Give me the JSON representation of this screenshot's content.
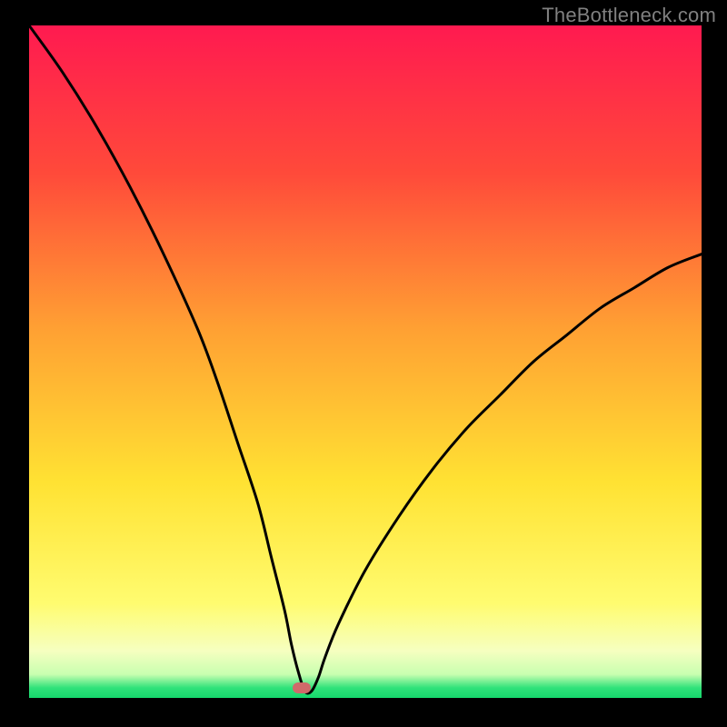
{
  "watermark": "TheBottleneck.com",
  "marker": {
    "color": "#d06a6a",
    "x_frac": 0.405,
    "y_frac": 0.985
  },
  "gradient": {
    "stops": [
      {
        "pos": 0.0,
        "color": "#ff1a50"
      },
      {
        "pos": 0.22,
        "color": "#ff4a3a"
      },
      {
        "pos": 0.45,
        "color": "#ffa033"
      },
      {
        "pos": 0.68,
        "color": "#ffe233"
      },
      {
        "pos": 0.86,
        "color": "#fffc70"
      },
      {
        "pos": 0.93,
        "color": "#f6ffc0"
      },
      {
        "pos": 0.965,
        "color": "#c8ffb0"
      },
      {
        "pos": 0.985,
        "color": "#2fe27a"
      },
      {
        "pos": 1.0,
        "color": "#16d86c"
      }
    ]
  },
  "chart_data": {
    "type": "line",
    "title": "",
    "xlabel": "",
    "ylabel": "",
    "xlim": [
      0,
      100
    ],
    "ylim": [
      0,
      100
    ],
    "grid": false,
    "legend": false,
    "annotations": [
      "TheBottleneck.com"
    ],
    "note": "Axes are unlabeled; x and y are normalized 0–100. Curve is a V-shaped bottleneck profile with minimum near x≈41. Background color encodes score: red (top, high) through yellow to green (very bottom, low).",
    "series": [
      {
        "name": "bottleneck-curve",
        "x": [
          0,
          5,
          10,
          15,
          20,
          25,
          28,
          31,
          34,
          36,
          38,
          39,
          40,
          41,
          42,
          43,
          44,
          46,
          50,
          55,
          60,
          65,
          70,
          75,
          80,
          85,
          90,
          95,
          100
        ],
        "y": [
          100,
          93,
          85,
          76,
          66,
          55,
          47,
          38,
          29,
          21,
          13,
          8,
          4,
          1,
          1,
          3,
          6,
          11,
          19,
          27,
          34,
          40,
          45,
          50,
          54,
          58,
          61,
          64,
          66
        ]
      }
    ],
    "marker_point": {
      "x": 41,
      "y": 1
    }
  }
}
